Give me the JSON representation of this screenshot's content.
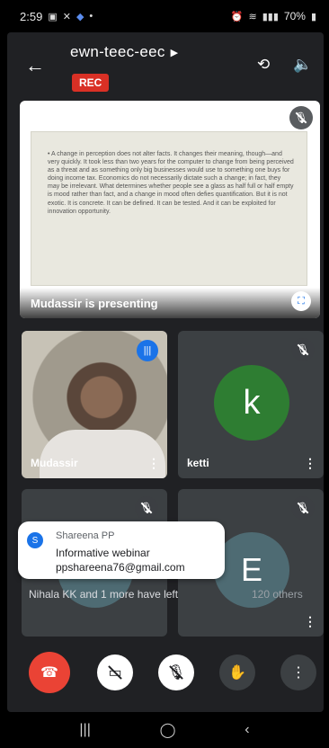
{
  "status_bar": {
    "time": "2:59",
    "battery": "70%",
    "left_icons": [
      "gallery-icon",
      "crossed-icon",
      "app-icon",
      "dot-icon"
    ],
    "right_icons": [
      "alarm-icon",
      "wifi-icon",
      "signal-icon",
      "battery-icon"
    ]
  },
  "header": {
    "meeting_code": "ewn-teec-eec",
    "rec_badge": "REC"
  },
  "presentation": {
    "slide_text": "• A change in perception does not alter facts. It changes their meaning, though—and very quickly. It took less than two years for the computer to change from being perceived as a threat and as something only big businesses would use to something one buys for doing income tax. Economics do not necessarily dictate such a change; in fact, they may be irrelevant. What determines whether people see a glass as half full or half empty is mood rather than fact, and a change in mood often defies quantification. But it is not exotic. It is concrete. It can be defined. It can be tested. And it can be exploited for innovation opportunity.",
    "caption": "Mudassir is presenting"
  },
  "participants": [
    {
      "name": "Mudassir"
    },
    {
      "name": "ketti",
      "initial": "k"
    }
  ],
  "hidden_tile": {
    "initial": "E"
  },
  "notification": {
    "sender": "Shareena PP",
    "avatar_initial": "S",
    "line1": "Informative webinar",
    "line2": "ppshareena76@gmail.com"
  },
  "footer": {
    "left_text": "Nihala KK and 1 more have left",
    "others_text": "120 others"
  },
  "colors": {
    "surface": "#202124",
    "tile": "#3c4043",
    "accent_blue": "#1a73e8",
    "rec_red": "#d93025",
    "end_call_red": "#ea4335",
    "avatar_green": "#2e7d32",
    "avatar_slate": "#4e6b73"
  }
}
